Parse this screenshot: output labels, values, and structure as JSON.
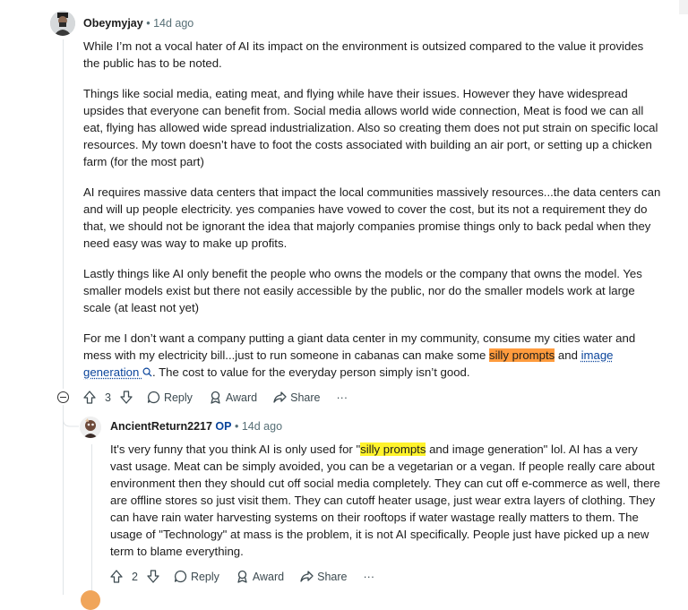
{
  "comment1": {
    "username": "Obeymyjay",
    "sep": "•",
    "time": "14d ago",
    "paragraphs": [
      "While I’m not a vocal hater of AI its impact on the environment is outsized compared to the value it provides the public has to be noted.",
      "Things like social media, eating meat, and flying while have their issues. However they have widespread upsides that everyone can benefit from. Social media allows world wide connection, Meat is food we can all eat, flying has allowed wide spread industrialization. Also so creating them does not put strain on specific local resources. My town doesn’t have to foot the costs associated with building an air port, or setting up a chicken farm (for the most part)",
      "AI requires massive data centers that impact the local communities massively resources...the data centers can and will up people electricity. yes companies have vowed to cover the cost, but its not a requirement they do that, we should not be ignorant the idea that majorly companies promise things only to back pedal when they need easy was way to make up profits.",
      "Lastly things like AI only benefit the people who owns the models or the company that owns the model. Yes smaller models exist but there not easily accessible by the public, nor do the smaller models work at large scale (at least not yet)"
    ],
    "last_para": {
      "before": "For me I don’t want a company putting a giant data center in my community, consume my cities water and mess with my electricity bill...just to run someone in cabanas can make some ",
      "highlight": "silly prompts",
      "middle": " and ",
      "link": "image generation",
      "after": ". The cost to value for the everyday person simply isn’t good."
    },
    "votes": "3",
    "reply_label": "Reply",
    "award_label": "Award",
    "share_label": "Share",
    "more_label": "···"
  },
  "comment2": {
    "username": "AncientReturn2217",
    "op_badge": "OP",
    "sep": "•",
    "time": "14d ago",
    "text_before": "It's very funny that you think AI is only used for \"",
    "highlight": "silly prompts",
    "text_after": " and image generation\" lol. AI has a very vast usage. Meat can be simply avoided, you can be a vegetarian or a vegan. If people really care about environment then they should cut off social media completely. They can cut off e-commerce as well, there are offline stores so just visit them. They can cutoff heater usage, just wear extra layers of clothing. They can have rain water harvesting systems on their rooftops if water wastage really matters to them. The usage of \"Technology\" at mass is the problem, it is not AI specifically. People just have picked up a new term to blame everything.",
    "votes": "2",
    "reply_label": "Reply",
    "award_label": "Award",
    "share_label": "Share",
    "more_label": "···"
  },
  "colors": {
    "highlight_orange": "#ff9b3d",
    "highlight_yellow": "#fff32b",
    "link": "#0a449b",
    "meta": "#576f76"
  }
}
